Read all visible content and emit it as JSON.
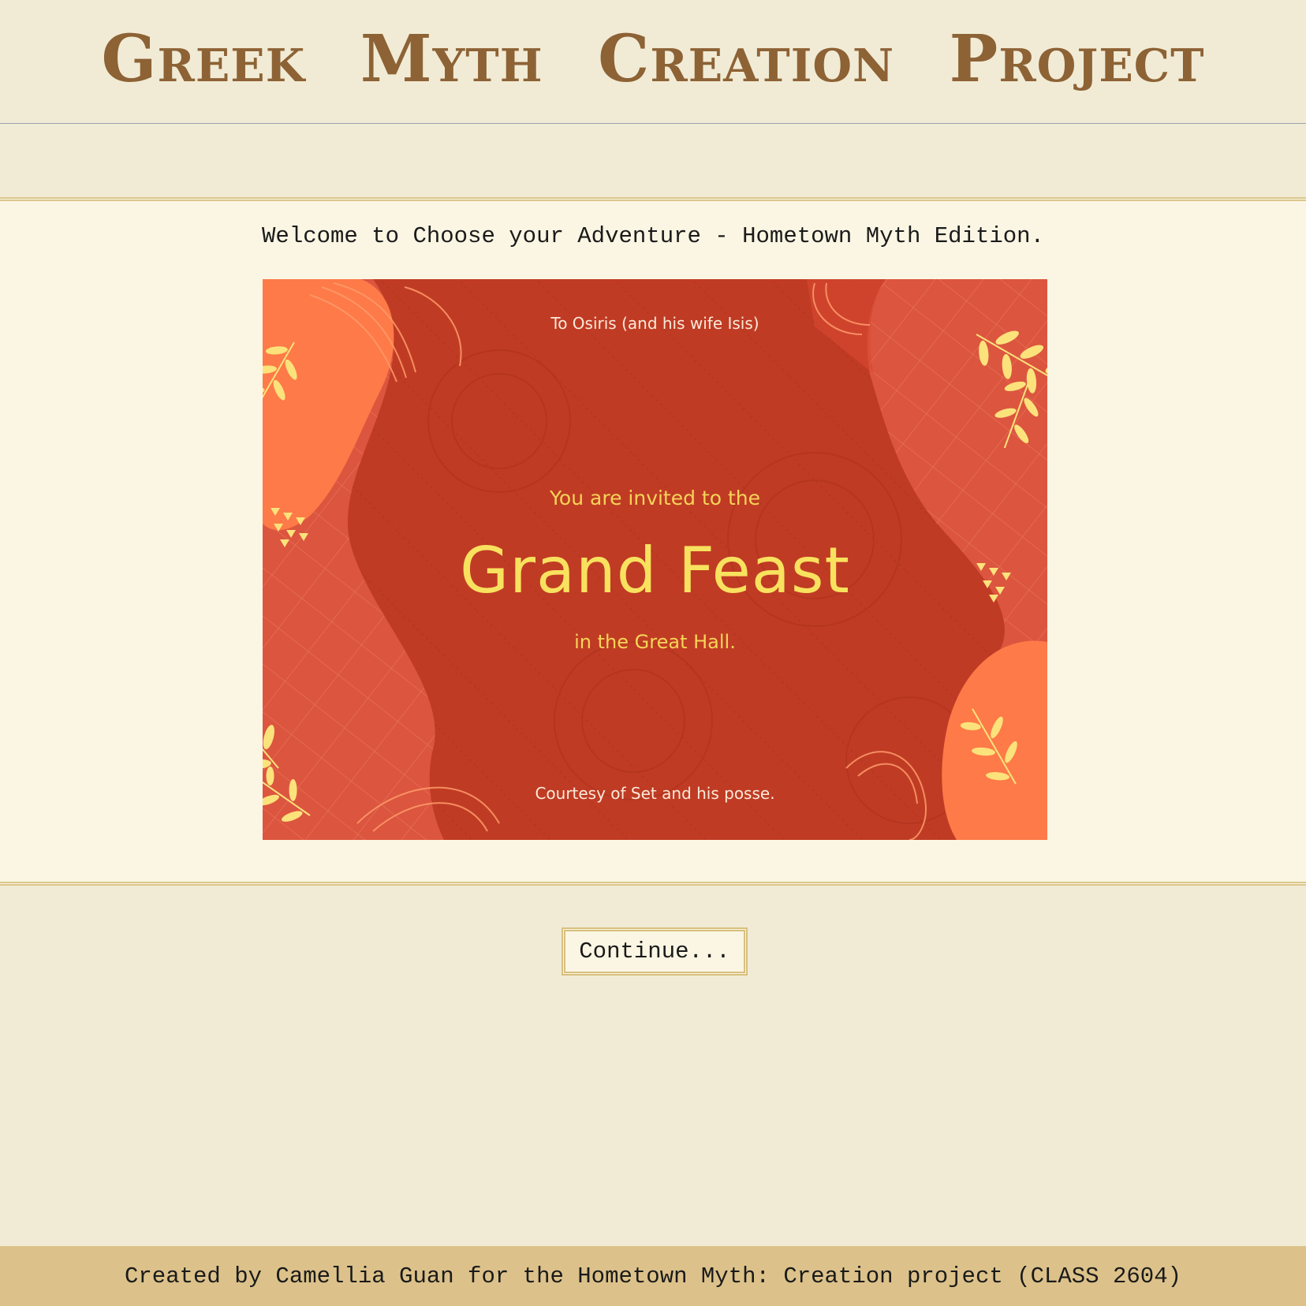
{
  "header": {
    "title": "Greek Myth Creation Project"
  },
  "main": {
    "welcome_text": "Welcome to Choose your Adventure - Hometown Myth Edition.",
    "invitation": {
      "recipient": "To Osiris (and his wife Isis)",
      "intro": "You are invited to the",
      "title": "Grand Feast",
      "location": "in the Great Hall.",
      "courtesy": "Courtesy of Set and his posse."
    },
    "continue_label": "Continue..."
  },
  "footer": {
    "credit": "Created by Camellia Guan for the Hometown Myth: Creation project (CLASS 2604)"
  },
  "colors": {
    "page_background": "#f1ebd5",
    "content_background": "#faf6e3",
    "title": "#8d6235",
    "border_gold": "#dcc68c",
    "footer_background": "#dcc28a",
    "invitation_red": "#c03b24",
    "invitation_orange": "#fe7a48",
    "invitation_yellow": "#f8e15e"
  }
}
